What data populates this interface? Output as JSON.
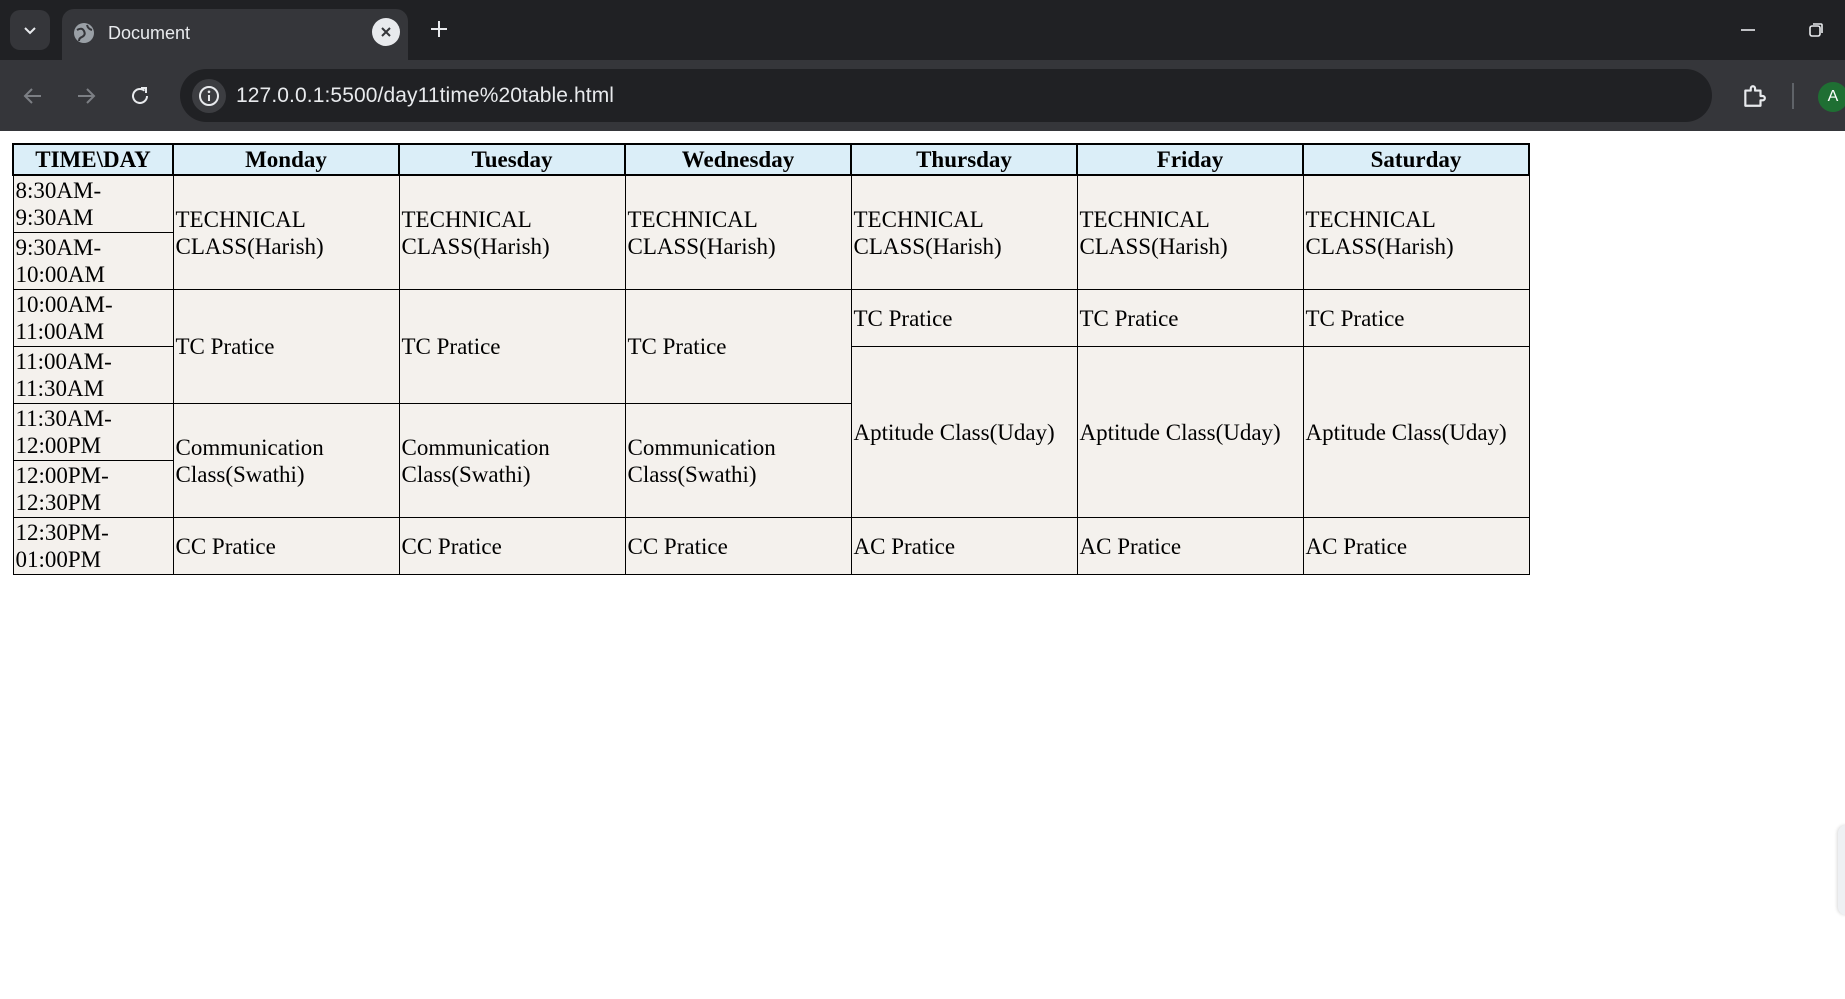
{
  "browser": {
    "tab": {
      "title": "Document"
    },
    "address_bar": {
      "url": "127.0.0.1:5500/day11time%20table.html"
    },
    "profile_initial": "A"
  },
  "timetable": {
    "headers": [
      "TIME\\DAY",
      "Monday",
      "Tuesday",
      "Wednesday",
      "Thursday",
      "Friday",
      "Saturday"
    ],
    "time_slots": [
      "8:30AM-9:30AM",
      "9:30AM-10:00AM",
      "10:00AM-11:00AM",
      "11:00AM-11:30AM",
      "11:30AM-12:00PM",
      "12:00PM-12:30PM",
      "12:30PM-01:00PM"
    ],
    "cells": {
      "technical": "TECHNICAL CLASS(Harish)",
      "tc_pratice": "TC Pratice",
      "communication": "Communication Class(Swathi)",
      "cc_pratice": "CC Pratice",
      "aptitude": "Aptitude Class(Uday)",
      "ac_pratice": "AC Pratice"
    }
  },
  "colors": {
    "header_bg": "#dbeef8",
    "cell_bg": "#f4f1ed",
    "chrome_dark": "#202124",
    "chrome_toolbar": "#35363a"
  }
}
